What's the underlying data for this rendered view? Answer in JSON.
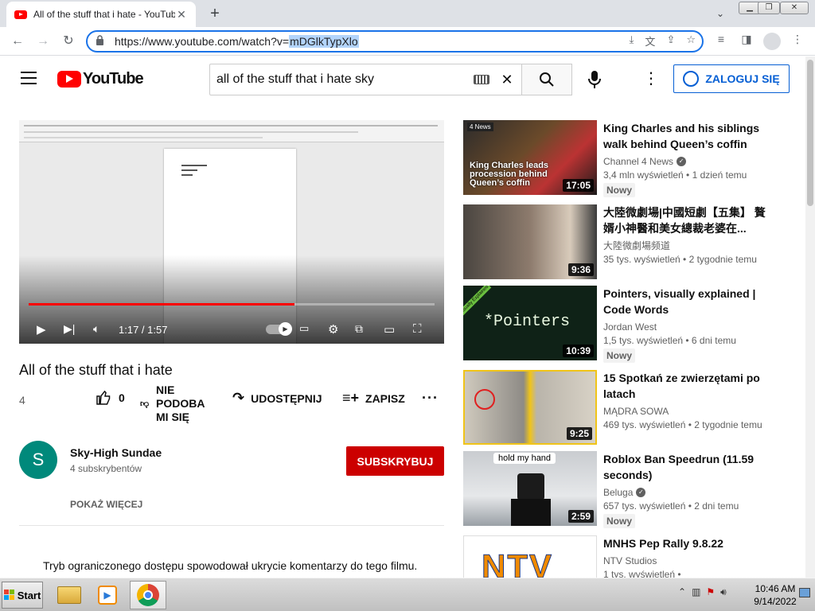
{
  "browser": {
    "tab_title": "All of the stuff that i hate - YouTube",
    "tab_close": "✕",
    "new_tab": "+",
    "url_prefix": "https://www.youtube.com/watch?v=",
    "url_selected": "mDGlkTypXlo"
  },
  "header": {
    "logo_text": "YouTube",
    "search_value": "all of the stuff that i hate sky",
    "signin_label": "ZALOGUJ SIĘ"
  },
  "player": {
    "time": "1:17 / 1:57",
    "progress_fraction": 0.655
  },
  "video": {
    "title": "All of the stuff that i hate",
    "views": "4",
    "like_count": "0",
    "dislike_label": "NIE PODOBA MI SIĘ",
    "share_label": "UDOSTĘPNIJ",
    "save_label": "ZAPISZ",
    "channel_initial": "S",
    "channel_name": "Sky-High Sundae",
    "subscribers": "4 subskrybentów",
    "subscribe_label": "SUBSKRYBUJ",
    "show_more": "POKAŻ WIĘCEJ",
    "comments_notice": "Tryb ograniczonego dostępu spowodował ukrycie komentarzy do tego filmu."
  },
  "recommendations": [
    {
      "title": "King Charles and his siblings walk behind Queen’s coffin",
      "channel": "Channel 4 News",
      "verified": true,
      "views": "3,4 mln wyświetleń • 1 dzień temu",
      "badge": "Nowy",
      "duration": "17:05",
      "thumb_text": "King Charles leads procession behind Queen’s coffin",
      "thumb_tag": "4 News"
    },
    {
      "title": "大陸微劇場|中國短劇【五集】 贅婿小神醫和美女總裁老婆在...",
      "channel": "大陸微劇場频道",
      "verified": false,
      "views": "35 tys. wyświetleń • 2 tygodnie temu",
      "badge": "",
      "duration": "9:36"
    },
    {
      "title": "Pointers, visually explained | Code Words",
      "channel": "Jordan West",
      "verified": false,
      "views": "1,5 tys. wyświetleń • 6 dni temu",
      "badge": "Nowy",
      "duration": "10:39",
      "thumb_text": "*Pointers",
      "thumb_tag": "Visually Explained"
    },
    {
      "title": "15 Spotkań ze zwierzętami po latach",
      "channel": "MĄDRA SOWA",
      "verified": false,
      "views": "469 tys. wyświetleń • 2 tygodnie temu",
      "badge": "",
      "duration": "9:25"
    },
    {
      "title": "Roblox Ban Speedrun (11.59 seconds)",
      "channel": "Beluga",
      "verified": true,
      "views": "657 tys. wyświetleń • 2 dni temu",
      "badge": "Nowy",
      "duration": "2:59",
      "thumb_text": "hold my hand"
    },
    {
      "title": "MNHS Pep Rally 9.8.22",
      "channel": "NTV Studios",
      "verified": false,
      "views": "1 tys. wyświetleń •",
      "badge": "",
      "duration": "",
      "thumb_text": "NTV"
    }
  ],
  "taskbar": {
    "start_label": "Start",
    "time": "10:46 AM",
    "date": "9/14/2022"
  },
  "colors": {
    "yt_red": "#ff0000",
    "subscribe_red": "#cc0000",
    "link_blue": "#065fd4",
    "omnibox_focus": "#1a73e8"
  }
}
